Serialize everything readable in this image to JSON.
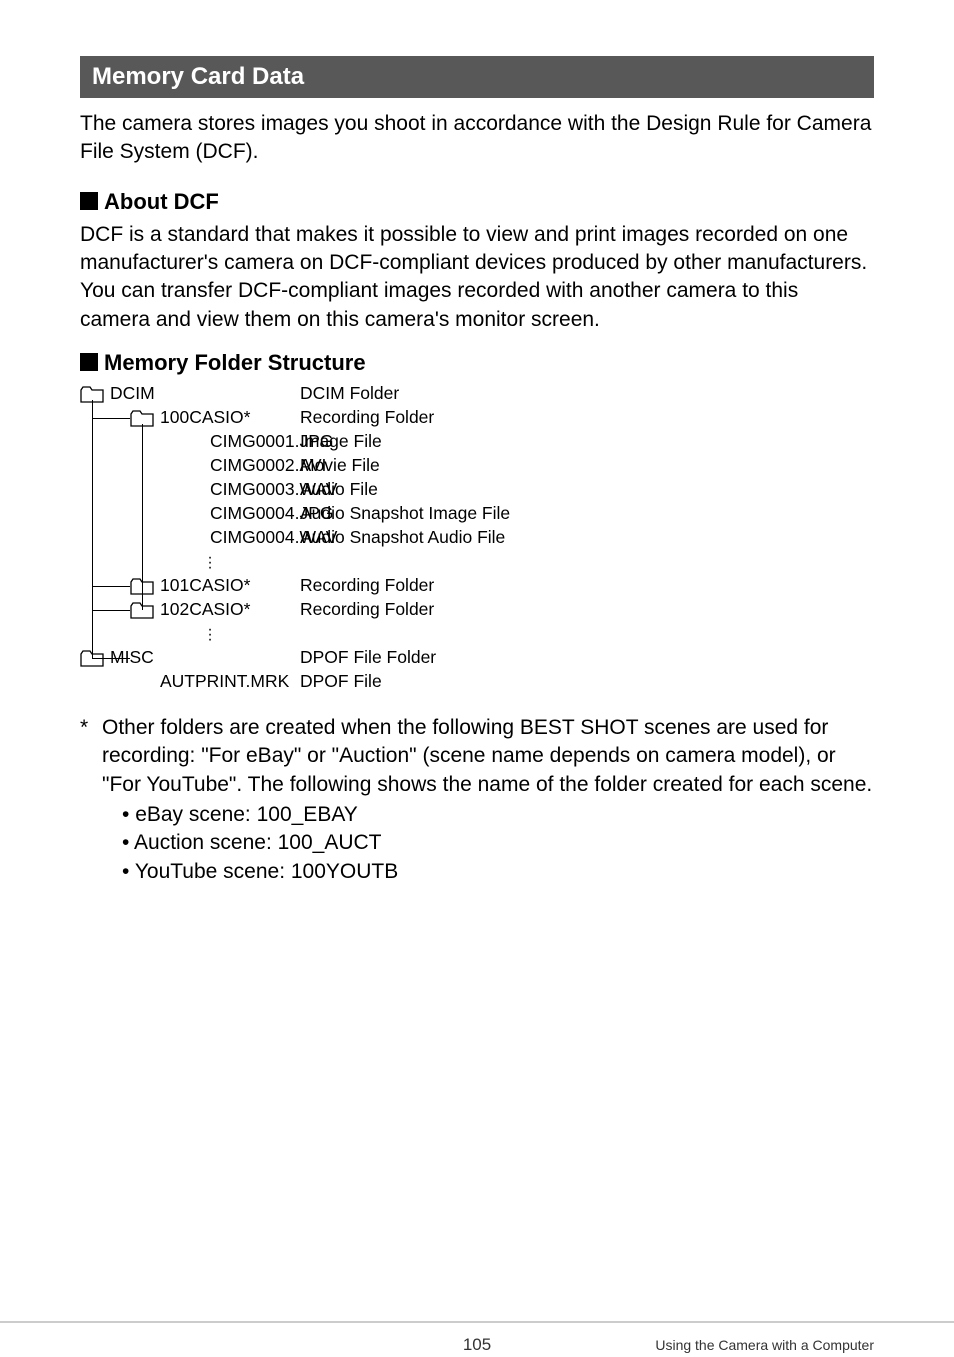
{
  "section": {
    "title": "Memory Card Data"
  },
  "intro": "The camera stores images you shoot in accordance with the Design Rule for Camera File System (DCF).",
  "about": {
    "heading": "About DCF",
    "body": "DCF is a standard that makes it possible to view and print images recorded on one manufacturer's camera on DCF-compliant devices produced by other manufacturers. You can transfer DCF-compliant images recorded with another camera to this camera and view them on this camera's monitor screen."
  },
  "structure": {
    "heading": "Memory Folder Structure"
  },
  "tree": {
    "rows": [
      {
        "indent": 0,
        "icon": true,
        "name": "DCIM",
        "star": false,
        "desc": "DCIM Folder"
      },
      {
        "indent": 1,
        "icon": true,
        "name": "100CASIO",
        "star": true,
        "desc": "Recording Folder"
      },
      {
        "indent": 2,
        "icon": false,
        "name": "CIMG0001.JPG",
        "star": false,
        "desc": "Image File"
      },
      {
        "indent": 2,
        "icon": false,
        "name": "CIMG0002.AVI",
        "star": false,
        "desc": "Movie File"
      },
      {
        "indent": 2,
        "icon": false,
        "name": "CIMG0003.WAV",
        "star": false,
        "desc": "Audio File"
      },
      {
        "indent": 2,
        "icon": false,
        "name": "CIMG0004.JPG",
        "star": false,
        "desc": "Audio Snapshot Image File"
      },
      {
        "indent": 2,
        "icon": false,
        "name": "CIMG0004.WAV",
        "star": false,
        "desc": "Audio Snapshot Audio File"
      },
      {
        "indent": 2,
        "icon": false,
        "name": "__VDOTS__",
        "star": false,
        "desc": ""
      },
      {
        "indent": 1,
        "icon": true,
        "name": "101CASIO",
        "star": true,
        "desc": "Recording Folder"
      },
      {
        "indent": 1,
        "icon": true,
        "name": "102CASIO",
        "star": true,
        "desc": "Recording Folder"
      },
      {
        "indent": 2,
        "icon": false,
        "name": "__VDOTS__",
        "star": false,
        "desc": ""
      },
      {
        "indent": 0,
        "icon": true,
        "name": "MISC",
        "star": false,
        "desc": "DPOF File Folder"
      },
      {
        "indent": 1,
        "icon": false,
        "name": "AUTPRINT.MRK",
        "star": false,
        "desc": "DPOF File"
      }
    ]
  },
  "footnote": {
    "lead": "Other folders are created when the following BEST SHOT scenes are used for recording: \"For eBay\" or \"Auction\" (scene name depends on camera model), or \"For YouTube\". The following shows the name of the folder created for each scene.",
    "items": [
      "eBay scene: 100_EBAY",
      "Auction scene: 100_AUCT",
      "YouTube scene: 100YOUTB"
    ]
  },
  "footer": {
    "page": "105",
    "chapter": "Using the Camera with a Computer"
  }
}
